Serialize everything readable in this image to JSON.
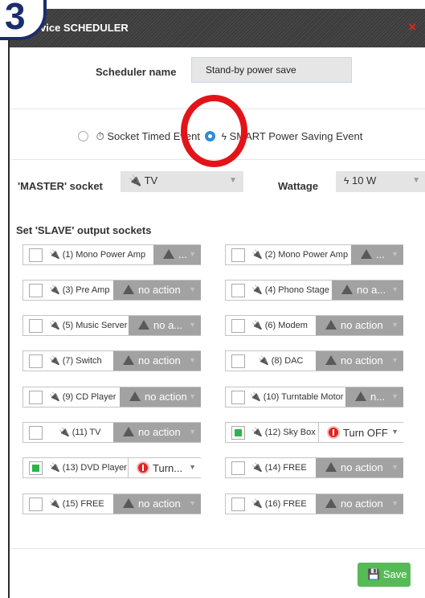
{
  "step_badge": "3",
  "dialog": {
    "title": "vice SCHEDULER",
    "close_icon": "×"
  },
  "scheduler": {
    "label": "Scheduler name",
    "value": "Stand-by power save"
  },
  "event_type": {
    "option1": "Socket Timed Event",
    "option2": "SMART Power Saving Event",
    "selected": "SMART Power Saving Event"
  },
  "master": {
    "label": "'MASTER' socket",
    "value": "TV",
    "wattage_label": "Wattage",
    "wattage_value": "10 W"
  },
  "slave_title": "Set 'SLAVE' output sockets",
  "sockets": [
    {
      "name": "(1) Mono Power Amp",
      "action": "...",
      "checked": false
    },
    {
      "name": "(2) Mono Power Amp",
      "action": "...",
      "checked": false
    },
    {
      "name": "(3) Pre Amp",
      "action": "no action",
      "checked": false
    },
    {
      "name": "(4) Phono Stage",
      "action": "no a...",
      "checked": false
    },
    {
      "name": "(5) Music Server",
      "action": "no a...",
      "checked": false
    },
    {
      "name": "(6) Modem",
      "action": "no action",
      "checked": false
    },
    {
      "name": "(7) Switch",
      "action": "no action",
      "checked": false
    },
    {
      "name": "(8) DAC",
      "action": "no action",
      "checked": false
    },
    {
      "name": "(9) CD Player",
      "action": "no action",
      "checked": false
    },
    {
      "name": "(10) Turntable Motor",
      "action": "n...",
      "checked": false
    },
    {
      "name": "(11) TV",
      "action": "no action",
      "checked": false
    },
    {
      "name": "(12) Sky Box",
      "action": "Turn OFF",
      "checked": true
    },
    {
      "name": "(13) DVD Player",
      "action": "Turn...",
      "checked": true
    },
    {
      "name": "(14) FREE",
      "action": "no action",
      "checked": false
    },
    {
      "name": "(15) FREE",
      "action": "no action",
      "checked": false
    },
    {
      "name": "(16) FREE",
      "action": "no action",
      "checked": false
    }
  ],
  "save_label": "Save",
  "colors": {
    "accent_blue": "#2e8bd8",
    "save_green": "#56bb56",
    "alert_red": "#e02424",
    "badge_navy": "#1b2d6b"
  }
}
